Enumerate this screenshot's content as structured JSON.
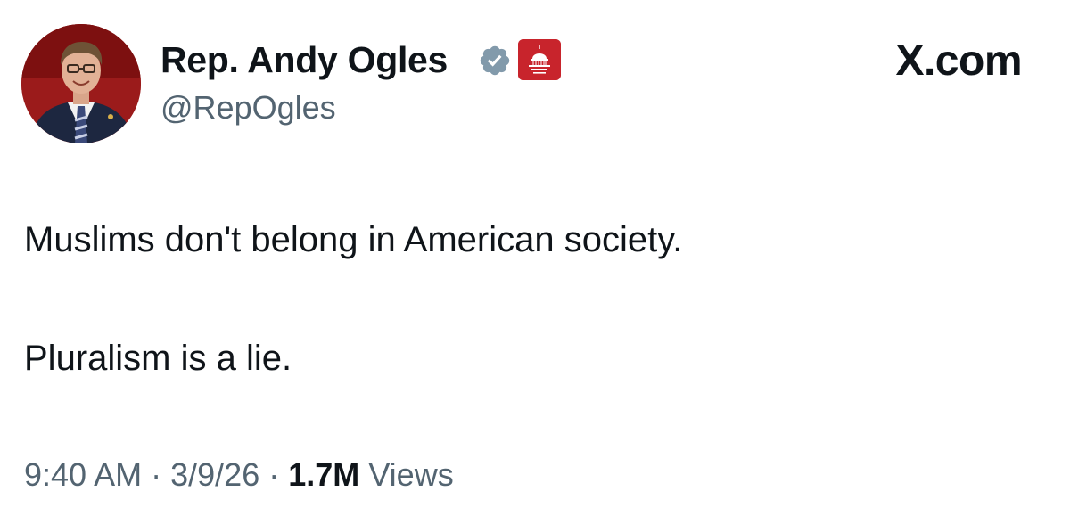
{
  "author": {
    "name": "Rep. Andy Ogles",
    "handle": "@RepOgles",
    "verified_icon": "verified-badge-icon",
    "affiliate_icon": "house-gop-capitol-icon",
    "verified_color": "#829aab",
    "affiliate_color": "#c8242c"
  },
  "site": {
    "logo": "X.com"
  },
  "tweet": {
    "lines": [
      "Muslims don't belong in American society.",
      "Pluralism is a lie."
    ]
  },
  "meta": {
    "time": "9:40 AM",
    "date": "3/9/26",
    "views_count": "1.7M",
    "views_label": "Views",
    "separator": "·"
  }
}
